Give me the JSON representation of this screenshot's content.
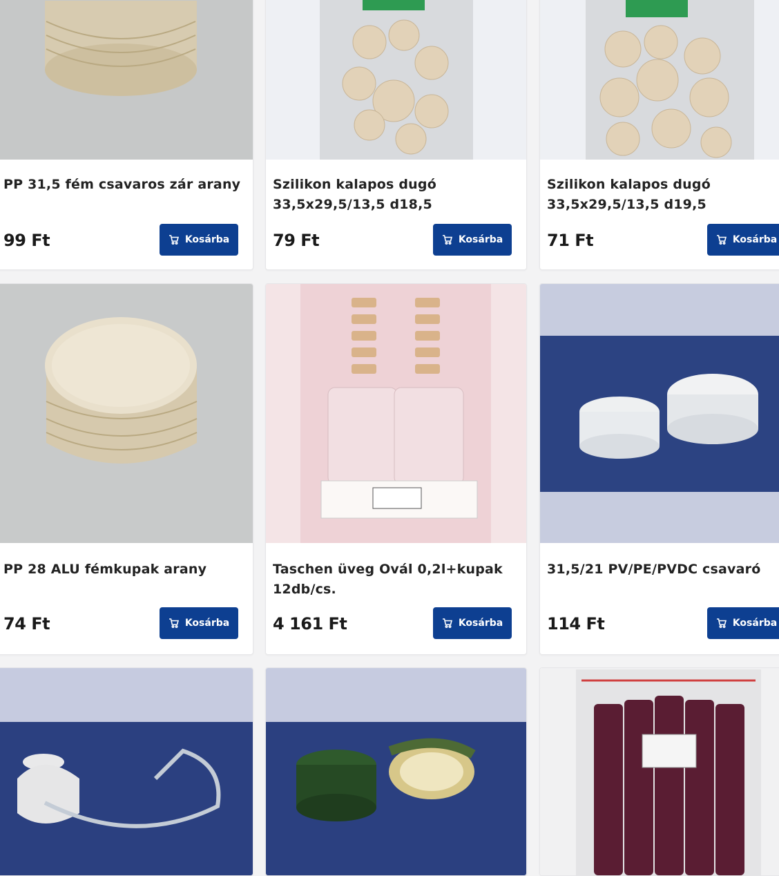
{
  "products": [
    {
      "name": "PP 31,5 fém csavaros zár arany",
      "price": "99 Ft",
      "button": "Kosárba",
      "icon": "cart-icon"
    },
    {
      "name": "Szilikon kalapos dugó 33,5x29,5/13,5 d18,5",
      "price": "79 Ft",
      "button": "Kosárba",
      "icon": "cart-icon"
    },
    {
      "name": "Szilikon kalapos dugó 33,5x29,5/13,5 d19,5",
      "price": "71 Ft",
      "button": "Kosárba",
      "icon": "cart-icon"
    },
    {
      "name": "PP 28 ALU fémkupak arany",
      "price": "74 Ft",
      "button": "Kosárba",
      "icon": "cart-icon"
    },
    {
      "name": "Taschen üveg Ovál 0,2l+kupak 12db/cs.",
      "price": "4 161 Ft",
      "button": "Kosárba",
      "icon": "cart-icon"
    },
    {
      "name": "31,5/21 PV/PE/PVDC csavaró",
      "price": "114 Ft",
      "button": "Kosárba",
      "icon": "cart-icon"
    }
  ],
  "colors": {
    "accent": "#0d3f91",
    "background": "#f3f3f4"
  }
}
